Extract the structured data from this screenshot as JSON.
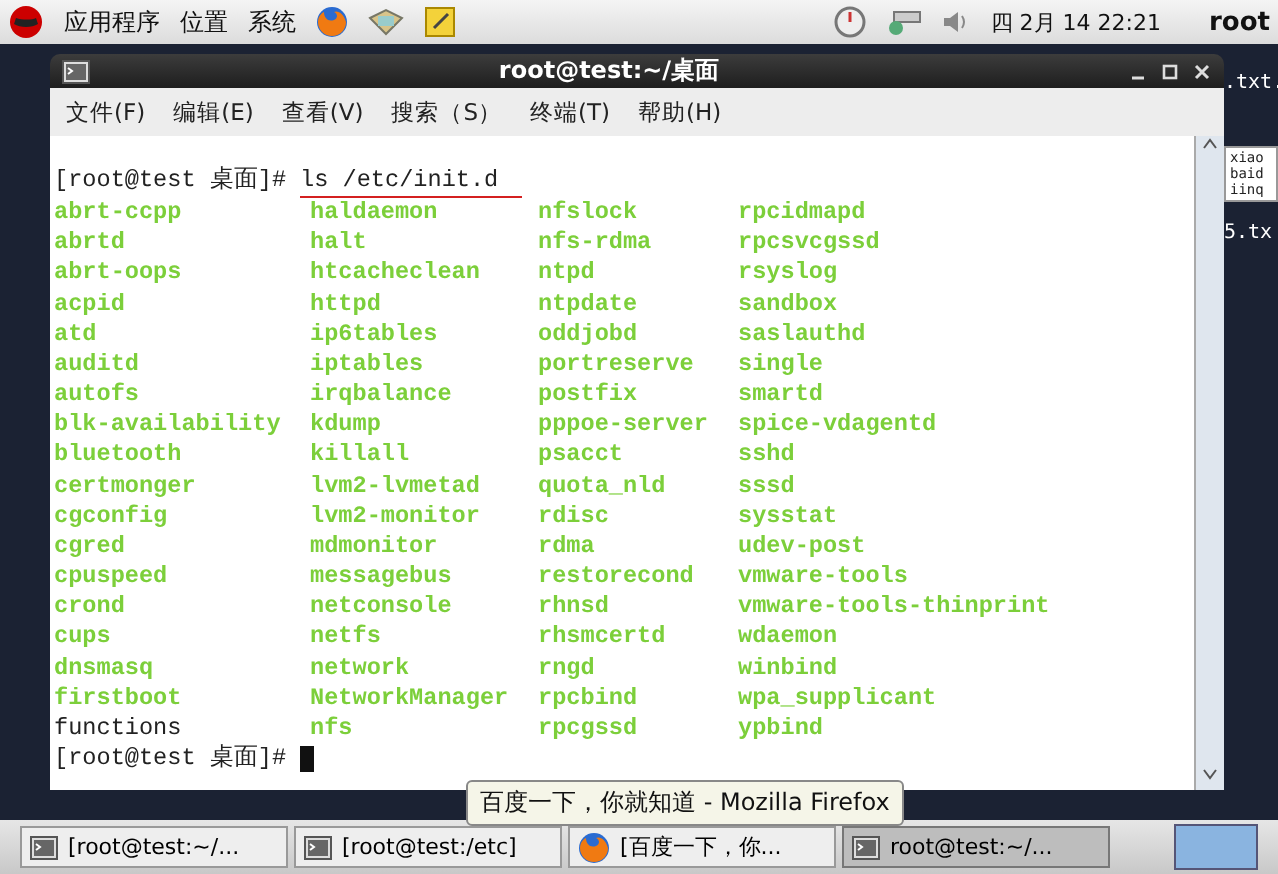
{
  "top_panel": {
    "menus": [
      "应用程序",
      "位置",
      "系统"
    ],
    "clock": "四 2月 14 22:21",
    "user": "root"
  },
  "window": {
    "title": "root@test:~/桌面",
    "menu": [
      "文件(F)",
      "编辑(E)",
      "查看(V)",
      "搜索（S）",
      "终端(T)",
      "帮助(H)"
    ],
    "terminal": {
      "prompt": "[root@test 桌面]#",
      "command": "ls /etc/init.d",
      "columns": [
        [
          {
            "name": "abrt-ccpp",
            "kind": "exec"
          },
          {
            "name": "abrtd",
            "kind": "exec"
          },
          {
            "name": "abrt-oops",
            "kind": "exec"
          },
          {
            "name": "acpid",
            "kind": "exec"
          },
          {
            "name": "atd",
            "kind": "exec"
          },
          {
            "name": "auditd",
            "kind": "exec"
          },
          {
            "name": "autofs",
            "kind": "exec"
          },
          {
            "name": "blk-availability",
            "kind": "exec"
          },
          {
            "name": "bluetooth",
            "kind": "exec"
          },
          {
            "name": "certmonger",
            "kind": "exec"
          },
          {
            "name": "cgconfig",
            "kind": "exec"
          },
          {
            "name": "cgred",
            "kind": "exec"
          },
          {
            "name": "cpuspeed",
            "kind": "exec"
          },
          {
            "name": "crond",
            "kind": "exec"
          },
          {
            "name": "cups",
            "kind": "exec"
          },
          {
            "name": "dnsmasq",
            "kind": "exec"
          },
          {
            "name": "firstboot",
            "kind": "exec"
          },
          {
            "name": "functions",
            "kind": "file"
          }
        ],
        [
          {
            "name": "haldaemon",
            "kind": "exec"
          },
          {
            "name": "halt",
            "kind": "exec"
          },
          {
            "name": "htcacheclean",
            "kind": "exec"
          },
          {
            "name": "httpd",
            "kind": "exec"
          },
          {
            "name": "ip6tables",
            "kind": "exec"
          },
          {
            "name": "iptables",
            "kind": "exec"
          },
          {
            "name": "irqbalance",
            "kind": "exec"
          },
          {
            "name": "kdump",
            "kind": "exec"
          },
          {
            "name": "killall",
            "kind": "exec"
          },
          {
            "name": "lvm2-lvmetad",
            "kind": "exec"
          },
          {
            "name": "lvm2-monitor",
            "kind": "exec"
          },
          {
            "name": "mdmonitor",
            "kind": "exec"
          },
          {
            "name": "messagebus",
            "kind": "exec"
          },
          {
            "name": "netconsole",
            "kind": "exec"
          },
          {
            "name": "netfs",
            "kind": "exec"
          },
          {
            "name": "network",
            "kind": "exec"
          },
          {
            "name": "NetworkManager",
            "kind": "exec"
          },
          {
            "name": "nfs",
            "kind": "exec"
          }
        ],
        [
          {
            "name": "nfslock",
            "kind": "exec"
          },
          {
            "name": "nfs-rdma",
            "kind": "exec"
          },
          {
            "name": "ntpd",
            "kind": "exec"
          },
          {
            "name": "ntpdate",
            "kind": "exec"
          },
          {
            "name": "oddjobd",
            "kind": "exec"
          },
          {
            "name": "portreserve",
            "kind": "exec"
          },
          {
            "name": "postfix",
            "kind": "exec"
          },
          {
            "name": "pppoe-server",
            "kind": "exec"
          },
          {
            "name": "psacct",
            "kind": "exec"
          },
          {
            "name": "quota_nld",
            "kind": "exec"
          },
          {
            "name": "rdisc",
            "kind": "exec"
          },
          {
            "name": "rdma",
            "kind": "exec"
          },
          {
            "name": "restorecond",
            "kind": "exec"
          },
          {
            "name": "rhnsd",
            "kind": "exec"
          },
          {
            "name": "rhsmcertd",
            "kind": "exec"
          },
          {
            "name": "rngd",
            "kind": "exec"
          },
          {
            "name": "rpcbind",
            "kind": "exec"
          },
          {
            "name": "rpcgssd",
            "kind": "exec"
          }
        ],
        [
          {
            "name": "rpcidmapd",
            "kind": "exec"
          },
          {
            "name": "rpcsvcgssd",
            "kind": "exec"
          },
          {
            "name": "rsyslog",
            "kind": "exec"
          },
          {
            "name": "sandbox",
            "kind": "exec"
          },
          {
            "name": "saslauthd",
            "kind": "exec"
          },
          {
            "name": "single",
            "kind": "exec"
          },
          {
            "name": "smartd",
            "kind": "exec"
          },
          {
            "name": "spice-vdagentd",
            "kind": "exec"
          },
          {
            "name": "sshd",
            "kind": "exec"
          },
          {
            "name": "sssd",
            "kind": "exec"
          },
          {
            "name": "sysstat",
            "kind": "exec"
          },
          {
            "name": "udev-post",
            "kind": "exec"
          },
          {
            "name": "vmware-tools",
            "kind": "exec"
          },
          {
            "name": "vmware-tools-thinprint",
            "kind": "exec"
          },
          {
            "name": "wdaemon",
            "kind": "exec"
          },
          {
            "name": "winbind",
            "kind": "exec"
          },
          {
            "name": "wpa_supplicant",
            "kind": "exec"
          },
          {
            "name": "ypbind",
            "kind": "exec"
          }
        ]
      ],
      "final_prompt": "[root@test 桌面]#"
    }
  },
  "desktop": {
    "icons": [
      {
        "label": ".txt."
      },
      {
        "label": "5.tx",
        "preview": [
          "xiao",
          "baid",
          "iinq"
        ]
      }
    ]
  },
  "tooltip": "百度一下，你就知道 - Mozilla Firefox",
  "taskbar": [
    {
      "label": "[root@test:~/...",
      "kind": "terminal",
      "selected": false
    },
    {
      "label": "[root@test:/etc]",
      "kind": "terminal",
      "selected": false
    },
    {
      "label": "[百度一下，你...",
      "kind": "browser",
      "selected": false
    },
    {
      "label": "root@test:~/...",
      "kind": "terminal",
      "selected": true
    }
  ]
}
